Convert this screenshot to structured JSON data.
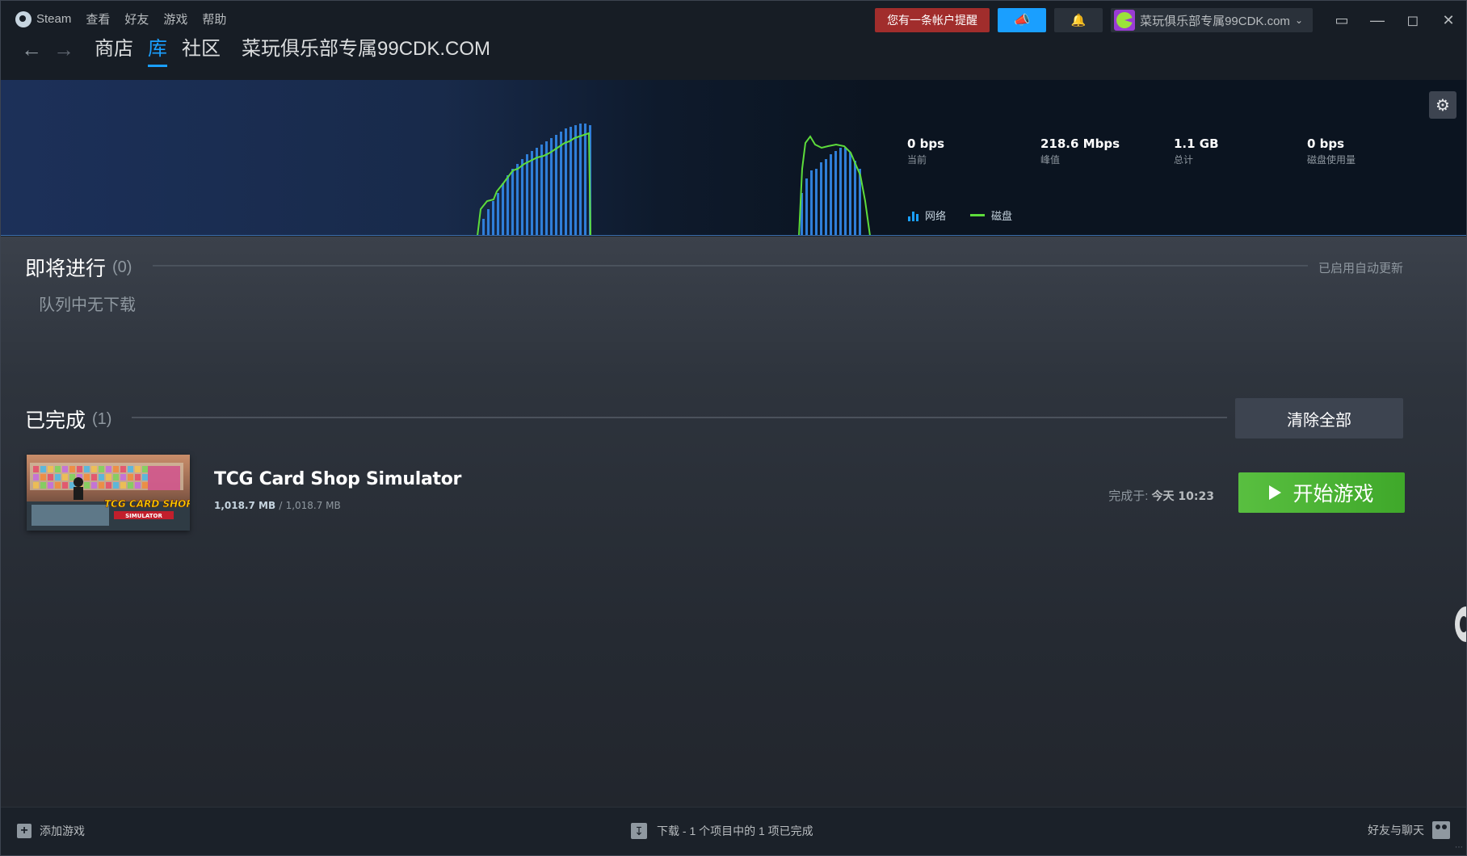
{
  "menubar": {
    "steam": "Steam",
    "view": "查看",
    "friends": "好友",
    "games": "游戏",
    "help": "帮助"
  },
  "nav": {
    "back_icon": "arrow-left-icon",
    "forward_icon": "arrow-right-icon",
    "store": "商店",
    "library": "库",
    "community": "社区",
    "username": "菜玩俱乐部专属99CDK.COM"
  },
  "topbar": {
    "account_alert": "您有一条帐户提醒",
    "account_name": "菜玩俱乐部专属99CDK.com",
    "colors": {
      "alert": "#a12d2c",
      "announce": "#1a9fff"
    }
  },
  "stats": {
    "current_value": "0 bps",
    "current_label": "当前",
    "peak_value": "218.6 Mbps",
    "peak_label": "峰值",
    "total_value": "1.1 GB",
    "total_label": "总计",
    "disk_value": "0 bps",
    "disk_label": "磁盘使用量"
  },
  "legend": {
    "network": "网络",
    "disk": "磁盘",
    "colors": {
      "network": "#1a9fff",
      "disk": "#5ddc3b"
    }
  },
  "queue": {
    "title": "即将进行",
    "count": "(0)",
    "auto_update": "已启用自动更新",
    "empty_text": "队列中无下载"
  },
  "completed": {
    "title": "已完成",
    "count": "(1)",
    "clear_all": "清除全部",
    "item": {
      "name": "TCG Card Shop Simulator",
      "downloaded": "1,018.7 MB",
      "separator": "/",
      "total": "1,018.7 MB",
      "completed_label": "完成于:",
      "completed_time": "今天 10:23",
      "play": "开始游戏",
      "capsule_logo_line1": "TCG CARD SHOP",
      "capsule_logo_line2": "SIMULATOR"
    }
  },
  "bottombar": {
    "add_game": "添加游戏",
    "download_status": "下载 - 1 个项目中的 1 项已完成",
    "friends_chat": "好友与聊天"
  }
}
